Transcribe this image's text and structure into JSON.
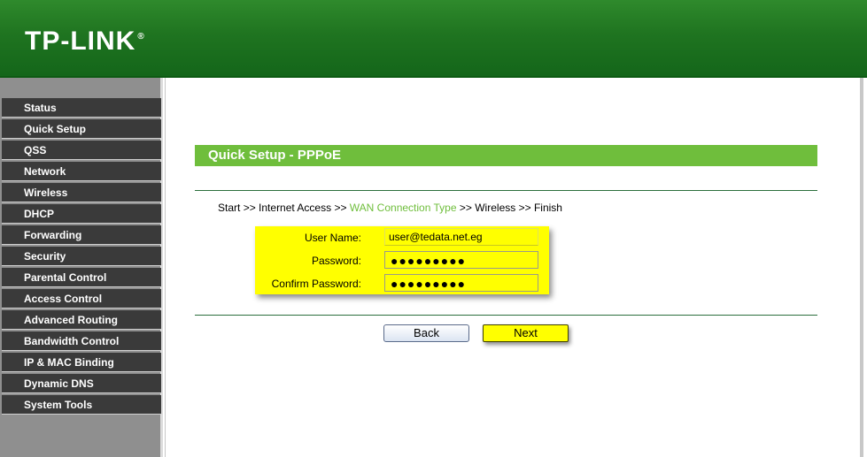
{
  "header": {
    "brand": "TP-LINK",
    "brand_mark": "®"
  },
  "sidebar": {
    "items": [
      {
        "label": "Status"
      },
      {
        "label": "Quick Setup"
      },
      {
        "label": "QSS"
      },
      {
        "label": "Network"
      },
      {
        "label": "Wireless"
      },
      {
        "label": "DHCP"
      },
      {
        "label": "Forwarding"
      },
      {
        "label": "Security"
      },
      {
        "label": "Parental Control"
      },
      {
        "label": "Access Control"
      },
      {
        "label": "Advanced Routing"
      },
      {
        "label": "Bandwidth Control"
      },
      {
        "label": "IP & MAC Binding"
      },
      {
        "label": "Dynamic DNS"
      },
      {
        "label": "System Tools"
      }
    ]
  },
  "main": {
    "title": "Quick Setup - PPPoE",
    "breadcrumb": {
      "step1": "Start",
      "sep": ">>",
      "step2": "Internet Access",
      "step3": "WAN Connection Type",
      "step4": "Wireless",
      "step5": "Finish"
    },
    "form": {
      "username_label": "User Name:",
      "username_value": "user@tedata.net.eg",
      "password_label": "Password:",
      "password_mask": "●●●●●●●●●",
      "confirm_label": "Confirm Password:",
      "confirm_mask": "●●●●●●●●●"
    },
    "buttons": {
      "back": "Back",
      "next": "Next"
    }
  },
  "colors": {
    "header_green": "#1f7420",
    "title_green": "#6fbe3c",
    "highlight_yellow": "#ffff00",
    "sidebar_item": "#3a3a3a",
    "sidebar_bg": "#8f8f8f"
  }
}
